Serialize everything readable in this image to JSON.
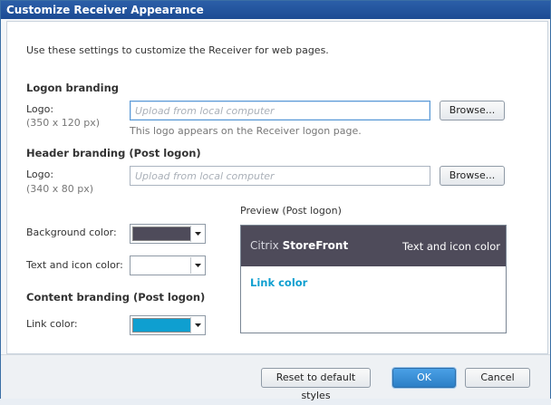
{
  "window": {
    "title": "Customize Receiver Appearance"
  },
  "intro": "Use these settings to customize the Receiver for web pages.",
  "logon_branding": {
    "heading": "Logon branding",
    "logo_label": "Logo:",
    "logo_size": "(350 x 120 px)",
    "placeholder": "Upload from local computer",
    "hint": "This logo appears on the Receiver logon page.",
    "browse_label": "Browse..."
  },
  "header_branding": {
    "heading": "Header branding (Post logon)",
    "logo_label": "Logo:",
    "logo_size": "(340 x 80 px)",
    "placeholder": "Upload from local computer",
    "browse_label": "Browse..."
  },
  "colors": {
    "background_label": "Background color:",
    "background_value": "#4e4b5a",
    "text_icon_label": "Text and icon color:",
    "text_icon_value": "#ffffff"
  },
  "content_branding": {
    "heading": "Content branding (Post logon)",
    "link_label": "Link color:",
    "link_value": "#0f9fd0"
  },
  "preview": {
    "heading": "Preview (Post logon)",
    "brand_prefix": "Citrix",
    "brand_name": "StoreFront",
    "header_text": "Text and icon color",
    "link_text": "Link color"
  },
  "footer": {
    "reset_label": "Reset to default styles",
    "ok_label": "OK",
    "cancel_label": "Cancel"
  }
}
